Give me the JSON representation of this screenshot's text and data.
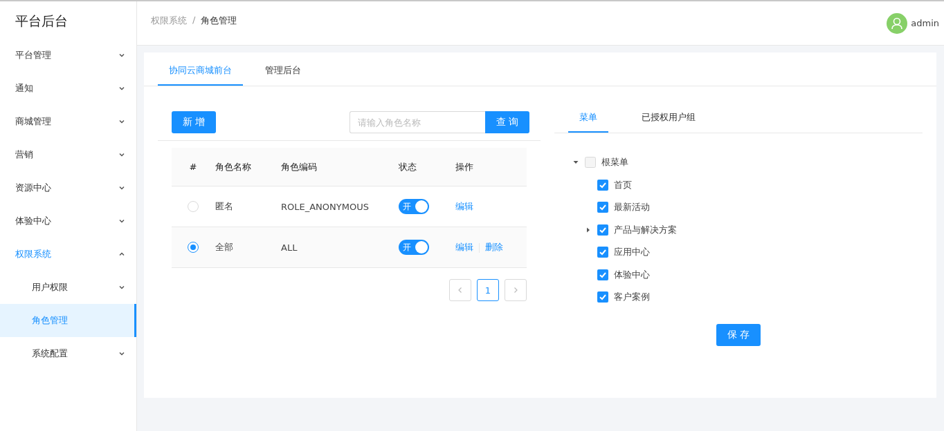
{
  "sidebar": {
    "title": "平台后台",
    "items": [
      {
        "label": "平台管理",
        "expanded": false,
        "selected": false
      },
      {
        "label": "通知",
        "expanded": false,
        "selected": false
      },
      {
        "label": "商城管理",
        "expanded": false,
        "selected": false
      },
      {
        "label": "营销",
        "expanded": false,
        "selected": false
      },
      {
        "label": "资源中心",
        "expanded": false,
        "selected": false
      },
      {
        "label": "体验中心",
        "expanded": false,
        "selected": false
      },
      {
        "label": "权限系统",
        "expanded": true,
        "selected": false,
        "children": [
          {
            "label": "用户权限",
            "expanded": false,
            "selected": false
          },
          {
            "label": "角色管理",
            "selected": true
          },
          {
            "label": "系统配置",
            "expanded": false,
            "selected": false
          }
        ]
      }
    ]
  },
  "header": {
    "breadcrumb": [
      "权限系统",
      "角色管理"
    ],
    "separator": "/",
    "user": "admin"
  },
  "tabs": [
    {
      "label": "协同云商城前台",
      "selected": true
    },
    {
      "label": "管理后台",
      "selected": false
    }
  ],
  "toolbar": {
    "add_button": "新 增",
    "search": {
      "placeholder": "请输入角色名称"
    },
    "search_button": "查 询"
  },
  "table": {
    "columns": [
      "#",
      "角色名称",
      "角色编码",
      "状态",
      "操作"
    ],
    "rows": [
      {
        "selected": false,
        "name": "匿名",
        "code": "ROLE_ANONYMOUS",
        "status": {
          "on": true,
          "label": "开"
        },
        "actions": [
          "编辑"
        ]
      },
      {
        "selected": true,
        "name": "全部",
        "code": "ALL",
        "status": {
          "on": true,
          "label": "开"
        },
        "actions": [
          "编辑",
          "删除"
        ]
      }
    ]
  },
  "pagination": {
    "pages": [
      {
        "label": "1",
        "selected": true
      }
    ]
  },
  "right_tabs": [
    {
      "label": "菜单",
      "selected": true
    },
    {
      "label": "已授权用户组",
      "selected": false
    }
  ],
  "tree": [
    {
      "label": "根菜单",
      "checked": false,
      "expanded": true,
      "children": [
        {
          "label": "首页",
          "checked": true
        },
        {
          "label": "最新活动",
          "checked": true
        },
        {
          "label": "产品与解决方案",
          "checked": true,
          "expanded": false
        },
        {
          "label": "应用中心",
          "checked": true
        },
        {
          "label": "体验中心",
          "checked": true
        },
        {
          "label": "客户案例",
          "checked": true
        }
      ]
    }
  ],
  "save_button": "保 存"
}
